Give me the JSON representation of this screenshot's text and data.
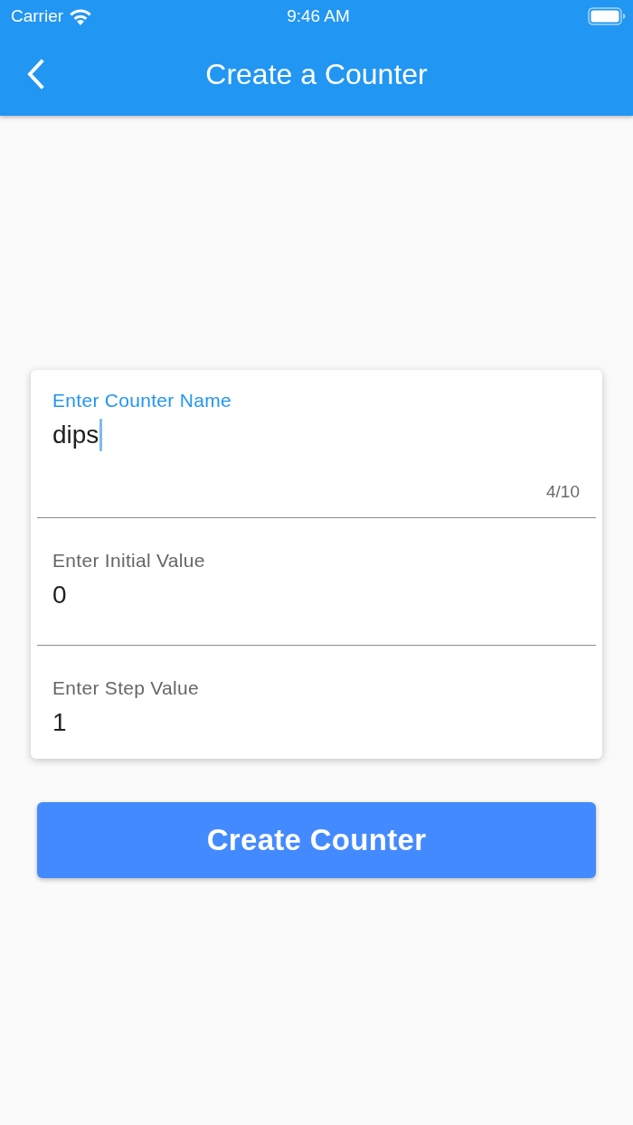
{
  "status_bar": {
    "carrier": "Carrier",
    "time": "9:46 AM"
  },
  "app_bar": {
    "title": "Create a Counter"
  },
  "form": {
    "fields": [
      {
        "label": "Enter Counter Name",
        "value": "dips",
        "focused": true,
        "counter": "4/10"
      },
      {
        "label": "Enter Initial Value",
        "value": "0",
        "focused": false
      },
      {
        "label": "Enter Step Value",
        "value": "1",
        "focused": false
      }
    ]
  },
  "submit_button": {
    "label": "Create Counter"
  }
}
